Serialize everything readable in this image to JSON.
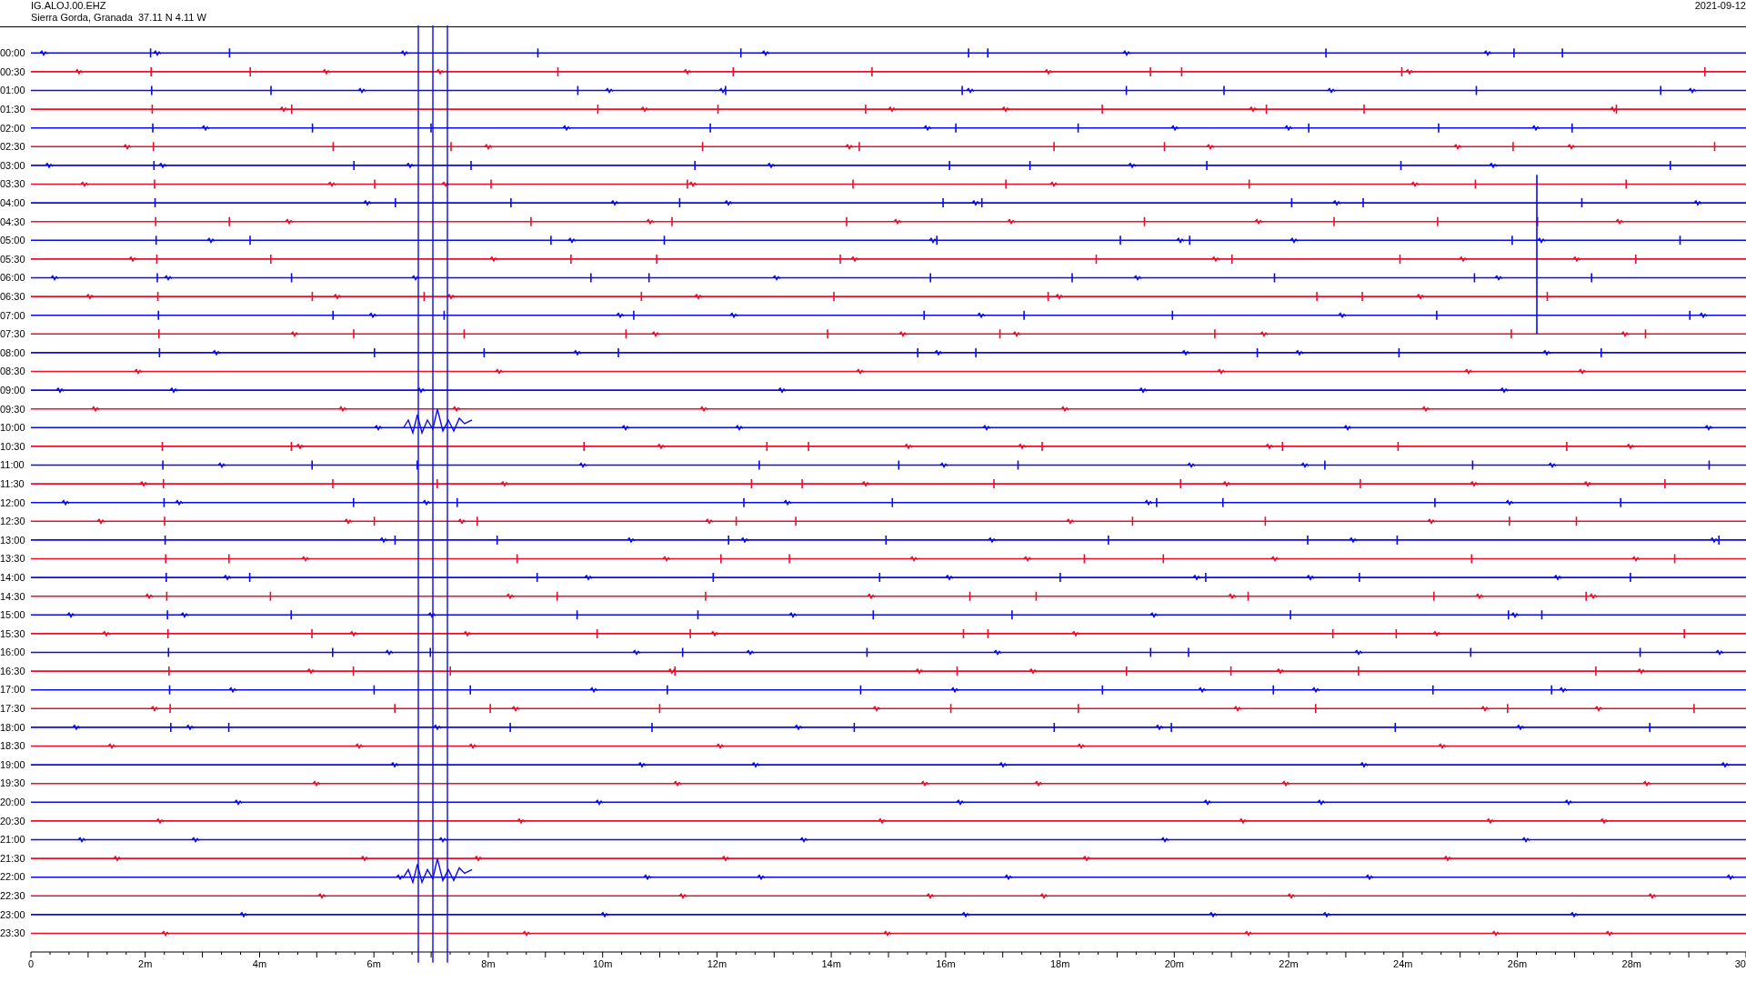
{
  "header": {
    "station": "IG.ALOJ.00.EHZ",
    "location": "Sierra Gorda, Granada  37.11 N 4.11 W",
    "date": "2021-09-12"
  },
  "rows": [
    {
      "time": "00:00",
      "color": "#0c0ce6"
    },
    {
      "time": "00:30",
      "color": "#e8102e"
    },
    {
      "time": "01:00",
      "color": "#0c0ce6"
    },
    {
      "time": "01:30",
      "color": "#e8102e"
    },
    {
      "time": "02:00",
      "color": "#0c0ce6"
    },
    {
      "time": "02:30",
      "color": "#e8102e"
    },
    {
      "time": "03:00",
      "color": "#0c0ce6"
    },
    {
      "time": "03:30",
      "color": "#e8102e"
    },
    {
      "time": "04:00",
      "color": "#0c0ce6"
    },
    {
      "time": "04:30",
      "color": "#e8102e"
    },
    {
      "time": "05:00",
      "color": "#0c0ce6"
    },
    {
      "time": "05:30",
      "color": "#e8102e"
    },
    {
      "time": "06:00",
      "color": "#0c0ce6"
    },
    {
      "time": "06:30",
      "color": "#e8102e"
    },
    {
      "time": "07:00",
      "color": "#0c0ce6"
    },
    {
      "time": "07:30",
      "color": "#e8102e"
    },
    {
      "time": "08:00",
      "color": "#0c0ce6"
    },
    {
      "time": "08:30",
      "color": "#e8102e"
    },
    {
      "time": "09:00",
      "color": "#0c0ce6"
    },
    {
      "time": "09:30",
      "color": "#e8102e"
    },
    {
      "time": "10:00",
      "color": "#0c0ce6"
    },
    {
      "time": "10:30",
      "color": "#e8102e"
    },
    {
      "time": "11:00",
      "color": "#0c0ce6"
    },
    {
      "time": "11:30",
      "color": "#e8102e"
    },
    {
      "time": "12:00",
      "color": "#0c0ce6"
    },
    {
      "time": "12:30",
      "color": "#e8102e"
    },
    {
      "time": "13:00",
      "color": "#0c0ce6"
    },
    {
      "time": "13:30",
      "color": "#e8102e"
    },
    {
      "time": "14:00",
      "color": "#0c0ce6"
    },
    {
      "time": "14:30",
      "color": "#e8102e"
    },
    {
      "time": "15:00",
      "color": "#0c0ce6"
    },
    {
      "time": "15:30",
      "color": "#e8102e"
    },
    {
      "time": "16:00",
      "color": "#0c0ce6"
    },
    {
      "time": "16:30",
      "color": "#e8102e"
    },
    {
      "time": "17:00",
      "color": "#0c0ce6"
    },
    {
      "time": "17:30",
      "color": "#e8102e"
    },
    {
      "time": "18:00",
      "color": "#0c0ce6"
    },
    {
      "time": "18:30",
      "color": "#e8102e"
    },
    {
      "time": "19:00",
      "color": "#0c0ce6"
    },
    {
      "time": "19:30",
      "color": "#e8102e"
    },
    {
      "time": "20:00",
      "color": "#0c0ce6"
    },
    {
      "time": "20:30",
      "color": "#e8102e"
    },
    {
      "time": "21:00",
      "color": "#0c0ce6"
    },
    {
      "time": "21:30",
      "color": "#e8102e"
    },
    {
      "time": "22:00",
      "color": "#0c0ce6"
    },
    {
      "time": "22:30",
      "color": "#e8102e"
    },
    {
      "time": "23:00",
      "color": "#0c0ce6"
    },
    {
      "time": "23:30",
      "color": "#e8102e"
    }
  ],
  "axis": {
    "ticks": [
      "0",
      "2m",
      "4m",
      "6m",
      "8m",
      "10m",
      "12m",
      "14m",
      "16m",
      "18m",
      "20m",
      "22m",
      "24m",
      "26m",
      "28m",
      "30"
    ]
  }
}
